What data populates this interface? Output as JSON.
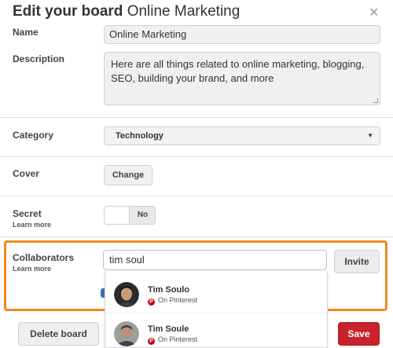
{
  "modal": {
    "title_prefix": "Edit your board",
    "title_board": "Online Marketing",
    "close_glyph": "✕"
  },
  "name": {
    "label": "Name",
    "value": "Online Marketing"
  },
  "description": {
    "label": "Description",
    "value": "Here are all things related to online marketing, blogging, SEO, building your brand, and more"
  },
  "category": {
    "label": "Category",
    "selected": "Technology",
    "caret": "▼"
  },
  "cover": {
    "label": "Cover",
    "button": "Change"
  },
  "secret": {
    "label": "Secret",
    "learn_more": "Learn more",
    "toggle_state": "No"
  },
  "collaborators": {
    "label": "Collaborators",
    "learn_more": "Learn more",
    "input_value": "tim soul",
    "invite_button": "Invite",
    "suggestions": [
      {
        "name": "Tim Soulo",
        "source": "On Pinterest"
      },
      {
        "name": "Tim Soule",
        "source": "On Pinterest"
      }
    ]
  },
  "footer": {
    "delete_button": "Delete board",
    "save_button": "Save"
  },
  "icons": {
    "pinterest": "pinterest-icon",
    "close": "close-icon",
    "dropdown": "chevron-down-icon"
  },
  "colors": {
    "highlight": "#f08a1c",
    "save": "#c8232c",
    "pinterest": "#bd081c"
  }
}
